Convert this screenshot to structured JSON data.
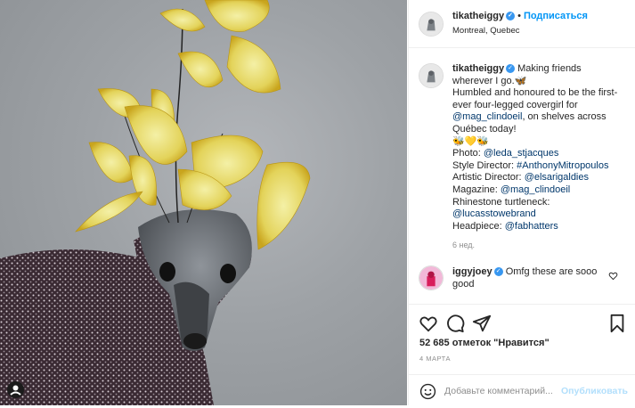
{
  "post": {
    "username": "tikatheiggy",
    "verified_glyph": "✓",
    "separator": "•",
    "follow_label": "Подписаться",
    "location": "Montreal, Quebec"
  },
  "caption": {
    "username": "tikatheiggy",
    "line1": "Making friends wherever I go.🦋",
    "line2_pre": "Humbled and honoured to be the first-ever four-legged covergirl for ",
    "line2_link": "@mag_clindoeil",
    "line2_post": ", on shelves across Québec today!",
    "emoji_line": "🐝💛🐝",
    "credits": [
      {
        "label": "Photo: ",
        "link": "@leda_stjacques"
      },
      {
        "label": "Style Director: ",
        "link": "#AnthonyMitropoulos"
      },
      {
        "label": "Artistic Director: ",
        "link": "@elsarigaldies"
      },
      {
        "label": "Magazine: ",
        "link": "@mag_clindoeil"
      },
      {
        "label": "Rhinestone turtleneck: ",
        "link": "@lucasstowebrand"
      },
      {
        "label": "Headpiece: ",
        "link": "@fabhatters"
      }
    ],
    "age": "6 нед."
  },
  "comment": {
    "username": "iggyjoey",
    "text": "Omfg these are sooo good",
    "cut_off_text": "…                    "
  },
  "actions": {
    "like_icon": "heart-icon",
    "comment_icon": "comment-icon",
    "share_icon": "share-icon",
    "save_icon": "bookmark-icon",
    "likes_text": "52 685 отметок \"Нравится\"",
    "date": "4 МАРТА"
  },
  "add_comment": {
    "placeholder": "Добавьте комментарий...",
    "publish_label": "Опубликовать"
  },
  "colors": {
    "accent": "#0095f6",
    "verified": "#3897f0",
    "link": "#00376b",
    "muted": "#8e8e8e"
  }
}
